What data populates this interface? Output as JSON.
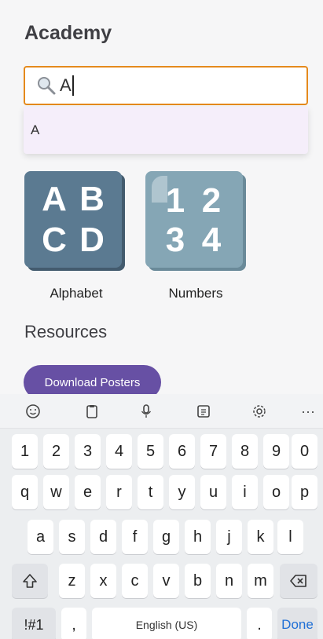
{
  "page": {
    "title": "Academy",
    "search": {
      "value": "A",
      "icon": "search-icon"
    },
    "suggestion": "A",
    "tiles": [
      {
        "label": "Alphabet",
        "glyphs": [
          "A",
          "B",
          "C",
          "D"
        ]
      },
      {
        "label": "Numbers",
        "glyphs": [
          "1",
          "2",
          "3",
          "4"
        ]
      }
    ],
    "resources_heading": "Resources",
    "download_button": "Download Posters"
  },
  "keyboard": {
    "toolbar": [
      "emoji-icon",
      "clipboard-icon",
      "microphone-icon",
      "text-mode-icon",
      "settings-icon",
      "more-icon"
    ],
    "more_label": "···",
    "row_numbers": [
      "1",
      "2",
      "3",
      "4",
      "5",
      "6",
      "7",
      "8",
      "9",
      "0"
    ],
    "row1": [
      "q",
      "w",
      "e",
      "r",
      "t",
      "y",
      "u",
      "i",
      "o",
      "p"
    ],
    "row2": [
      "a",
      "s",
      "d",
      "f",
      "g",
      "h",
      "j",
      "k",
      "l"
    ],
    "row3": [
      "z",
      "x",
      "c",
      "v",
      "b",
      "n",
      "m"
    ],
    "symbols_label": "!#1",
    "comma_label": ",",
    "space_label": "English (US)",
    "period_label": ".",
    "done_label": "Done"
  },
  "colors": {
    "accent": "#e58a1c",
    "button": "#6750a4",
    "suggestion_bg": "#f5eefa",
    "done": "#1f6fd6"
  }
}
